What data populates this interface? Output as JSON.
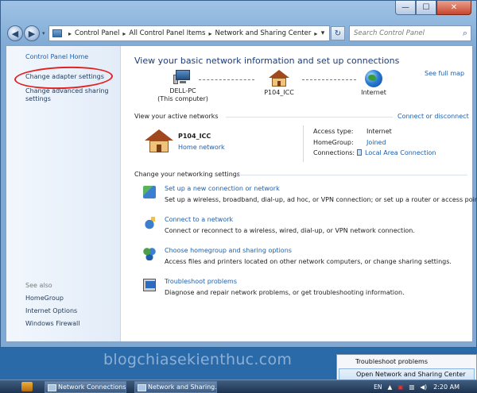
{
  "window": {
    "controls": {
      "minimize": "—",
      "maximize": "☐",
      "close": "✕"
    }
  },
  "navbar": {
    "back": "◀",
    "forward": "▶",
    "history": "▾",
    "breadcrumb": [
      "Control Panel",
      "All Control Panel Items",
      "Network and Sharing Center"
    ],
    "separator": "▸",
    "dropdown": "▾",
    "refresh": "↻",
    "search_placeholder": "Search Control Panel",
    "search_icon": "⌕"
  },
  "sidebar": {
    "home": "Control Panel Home",
    "adapter": "Change adapter settings",
    "advanced": "Change advanced sharing settings",
    "see_also": "See also",
    "footer": [
      "HomeGroup",
      "Internet Options",
      "Windows Firewall"
    ]
  },
  "main": {
    "title": "View your basic network information and set up connections",
    "see_full_map": "See full map",
    "map": {
      "computer": "DELL-PC",
      "computer_sub": "(This computer)",
      "network": "P104_ICC",
      "internet": "Internet"
    },
    "active_label": "View your active networks",
    "connect_disconnect": "Connect or disconnect",
    "active_network": {
      "name": "P104_ICC",
      "type": "Home network",
      "access_type_label": "Access type:",
      "access_type_value": "Internet",
      "homegroup_label": "HomeGroup:",
      "homegroup_value": "Joined",
      "connections_label": "Connections:",
      "connections_value": "Local Area Connection"
    },
    "change_label": "Change your networking settings",
    "tasks": [
      {
        "title": "Set up a new connection or network",
        "desc": "Set up a wireless, broadband, dial-up, ad hoc, or VPN connection; or set up a router or access point.",
        "icon": "network-setup-icon"
      },
      {
        "title": "Connect to a network",
        "desc": "Connect or reconnect to a wireless, wired, dial-up, or VPN network connection.",
        "icon": "connect-network-icon"
      },
      {
        "title": "Choose homegroup and sharing options",
        "desc": "Access files and printers located on other network computers, or change sharing settings.",
        "icon": "homegroup-icon"
      },
      {
        "title": "Troubleshoot problems",
        "desc": "Diagnose and repair network problems, or get troubleshooting information.",
        "icon": "troubleshoot-icon"
      }
    ]
  },
  "watermark": "blogchiasekienthuc.com",
  "context_menu": {
    "items": [
      "Troubleshoot problems",
      "Open Network and Sharing Center"
    ]
  },
  "taskbar": {
    "apps": [
      "Network Connections",
      "Network and Sharing..."
    ],
    "language": "EN",
    "clock": "2:20 AM"
  },
  "colors": {
    "link": "#1b5fb0",
    "highlight_oval": "#e22222",
    "title": "#1e3c78"
  }
}
